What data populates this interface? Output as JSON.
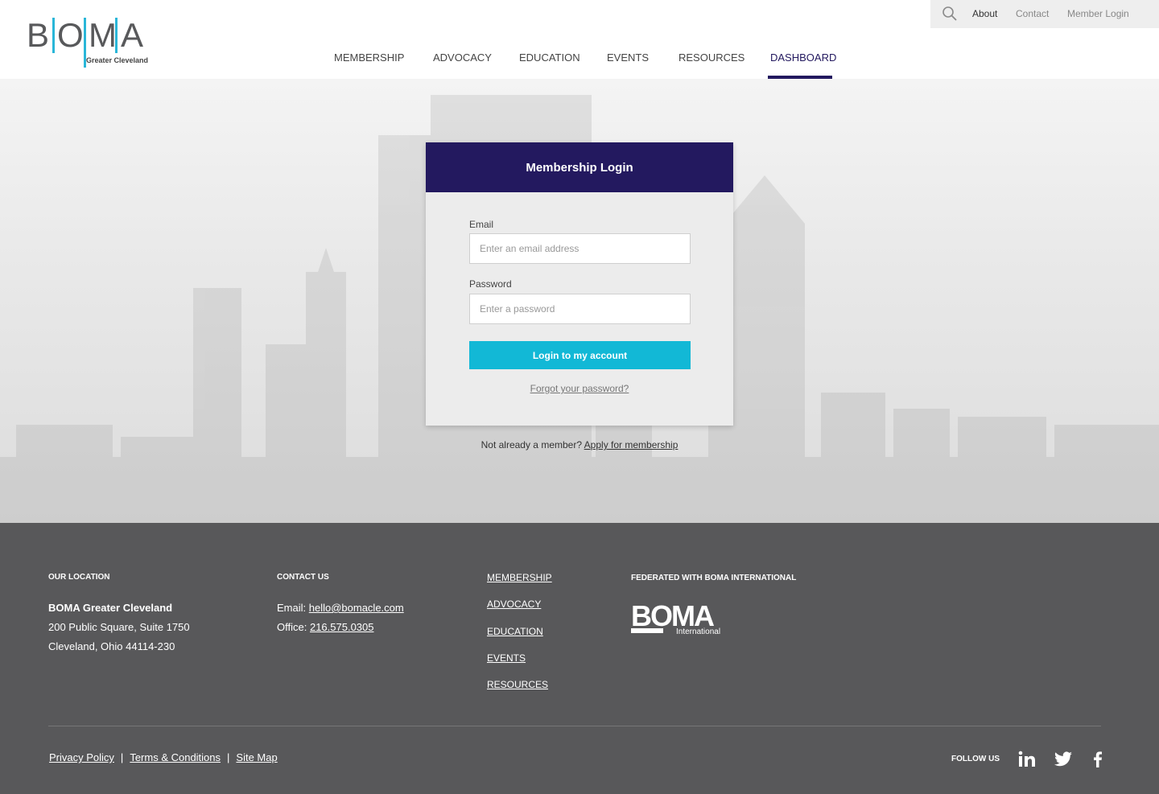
{
  "header": {
    "logo": {
      "letters": [
        "B",
        "O",
        "M",
        "A"
      ],
      "subtitle": "Greater Cleveland"
    },
    "utility": {
      "search_icon": "search-icon",
      "about": "About",
      "contact": "Contact",
      "member_login": "Member Login"
    },
    "nav": [
      {
        "label": "MEMBERSHIP",
        "active": false
      },
      {
        "label": "ADVOCACY",
        "active": false
      },
      {
        "label": "EDUCATION",
        "active": false
      },
      {
        "label": "EVENTS",
        "active": false
      },
      {
        "label": "RESOURCES",
        "active": false
      },
      {
        "label": "DASHBOARD",
        "active": true
      }
    ]
  },
  "login": {
    "title": "Membership Login",
    "email_label": "Email",
    "email_placeholder": "Enter an email address",
    "password_label": "Password",
    "password_placeholder": "Enter a password",
    "submit": "Login to my account",
    "forgot": "Forgot your password?",
    "not_member": "Not already a member?",
    "apply": "Apply for membership"
  },
  "footer": {
    "location": {
      "heading": "OUR LOCATION",
      "name": "BOMA Greater Cleveland",
      "address1": "200 Public Square, Suite 1750",
      "address2": "Cleveland, Ohio 44114-230"
    },
    "contact": {
      "heading": "CONTACT US",
      "email_label": "Email:",
      "email": "hello@bomacle.com",
      "office_label": "Office:",
      "phone": "216.575.0305"
    },
    "links": [
      "MEMBERSHIP",
      "ADVOCACY",
      "EDUCATION",
      "EVENTS",
      "RESOURCES"
    ],
    "federated": {
      "heading": "FEDERATED WITH BOMA INTERNATIONAL",
      "logo_word": "BOMA",
      "logo_sub": "International"
    },
    "legal": [
      "Privacy Policy",
      "Terms & Conditions",
      "Site Map"
    ],
    "follow": "FOLLOW US",
    "social": [
      "linkedin-icon",
      "twitter-icon",
      "facebook-icon"
    ]
  },
  "colors": {
    "brand_navy": "#23195f",
    "accent_cyan": "#12b8d6",
    "logo_cyan": "#29b6d8",
    "footer_bg": "#58585a"
  }
}
